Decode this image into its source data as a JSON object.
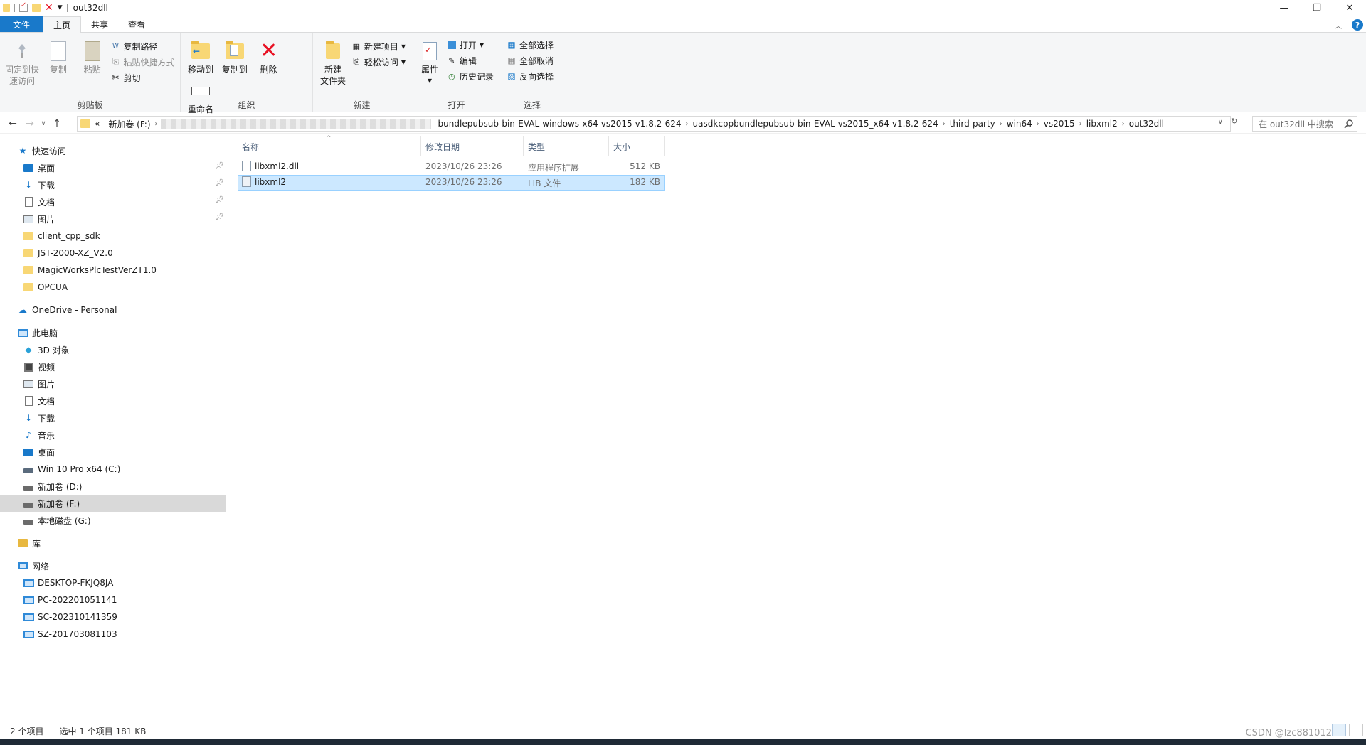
{
  "window": {
    "title": "out32dll",
    "minimize": "—",
    "restore": "❐",
    "close": "✕"
  },
  "ribbon_tabs": [
    {
      "label": "文件"
    },
    {
      "label": "主页"
    },
    {
      "label": "共享"
    },
    {
      "label": "查看"
    }
  ],
  "ribbon": {
    "clipboard": {
      "group_label": "剪贴板",
      "pin_label_1": "固定到快",
      "pin_label_2": "速访问",
      "copy_label": "复制",
      "paste_label": "粘贴",
      "copy_path_label": "复制路径",
      "paste_shortcut_label": "粘贴快捷方式",
      "cut_label": "剪切"
    },
    "organize": {
      "group_label": "组织",
      "move_to_label": "移动到",
      "copy_to_label": "复制到",
      "delete_label": "删除",
      "rename_label": "重命名"
    },
    "new": {
      "group_label": "新建",
      "new_folder_label_1": "新建",
      "new_folder_label_2": "文件夹",
      "new_item_label": "新建项目",
      "easy_access_label": "轻松访问"
    },
    "open": {
      "group_label": "打开",
      "properties_label": "属性",
      "open_label": "打开",
      "edit_label": "编辑",
      "history_label": "历史记录"
    },
    "select": {
      "group_label": "选择",
      "select_all_label": "全部选择",
      "select_none_label": "全部取消",
      "invert_label": "反向选择"
    }
  },
  "address": {
    "overflow": "«",
    "crumbs": [
      "新加卷 (F:)",
      "bundlepubsub-bin-EVAL-windows-x64-vs2015-v1.8.2-624",
      "uasdkcppbundlepubsub-bin-EVAL-vs2015_x64-v1.8.2-624",
      "third-party",
      "win64",
      "vs2015",
      "libxml2",
      "out32dll"
    ],
    "search_placeholder": "在 out32dll 中搜索"
  },
  "nav_pane": {
    "quick_access": "快速访问",
    "quick_items": [
      "桌面",
      "下载",
      "文档",
      "图片",
      "client_cpp_sdk",
      "JST-2000-XZ_V2.0",
      "MagicWorksPlcTestVerZT1.0",
      "OPCUA"
    ],
    "onedrive": "OneDrive - Personal",
    "this_pc": "此电脑",
    "pc_items": [
      "3D 对象",
      "视频",
      "图片",
      "文档",
      "下载",
      "音乐",
      "桌面",
      "Win 10 Pro x64 (C:)",
      "新加卷 (D:)",
      "新加卷 (F:)",
      "本地磁盘 (G:)"
    ],
    "libraries": "库",
    "network": "网络",
    "network_items": [
      "DESKTOP-FKJQ8JA",
      "PC-202201051141",
      "SC-202310141359",
      "SZ-201703081103"
    ]
  },
  "file_list": {
    "columns": [
      "名称",
      "修改日期",
      "类型",
      "大小"
    ],
    "rows": [
      {
        "name": "libxml2.dll",
        "date": "2023/10/26 23:26",
        "type": "应用程序扩展",
        "size": "512 KB",
        "selected": false
      },
      {
        "name": "libxml2",
        "date": "2023/10/26 23:26",
        "type": "LIB 文件",
        "size": "182 KB",
        "selected": true
      }
    ]
  },
  "status": {
    "item_count": "2 个项目",
    "selected_info": "选中 1 个项目  181 KB"
  },
  "watermark": "CSDN @lzc881012",
  "colors": {
    "accent": "#1979ca",
    "selection": "#cce8ff",
    "folder": "#f8d775"
  }
}
